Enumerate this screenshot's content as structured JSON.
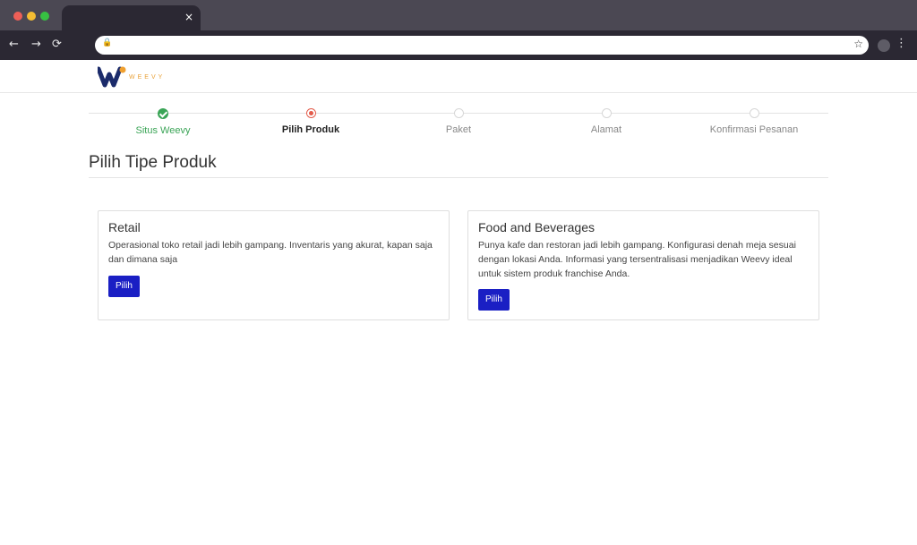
{
  "browser": {
    "tab_close": "×",
    "back": "←",
    "forward": "→",
    "reload": "⟳",
    "lock": "🔒",
    "star": "☆",
    "menu": "⋮"
  },
  "header": {
    "logo_text": "WEEVY",
    "brand_colors": {
      "navy": "#1b2b6b",
      "orange": "#f0a02f"
    }
  },
  "stepper": {
    "steps": [
      {
        "label": "Situs Weevy",
        "state": "done"
      },
      {
        "label": "Pilih Produk",
        "state": "active"
      },
      {
        "label": "Paket",
        "state": "pending"
      },
      {
        "label": "Alamat",
        "state": "pending"
      },
      {
        "label": "Konfirmasi Pesanan",
        "state": "pending"
      }
    ],
    "colors": {
      "done": "#3aa456",
      "active": "#e35b4a",
      "pending": "#d6d6d6"
    }
  },
  "main": {
    "title": "Pilih Tipe Produk",
    "cards": [
      {
        "title": "Retail",
        "description": "Operasional toko retail jadi lebih gampang. Inventaris yang akurat, kapan saja dan dimana saja",
        "button": "Pilih"
      },
      {
        "title": "Food and Beverages",
        "description": "Punya kafe dan restoran jadi lebih gampang. Konfigurasi denah meja sesuai dengan lokasi Anda. Informasi yang tersentralisasi menjadikan Weevy ideal untuk sistem produk franchise Anda.",
        "button": "Pilih"
      }
    ],
    "button_color": "#1a1fc4"
  }
}
